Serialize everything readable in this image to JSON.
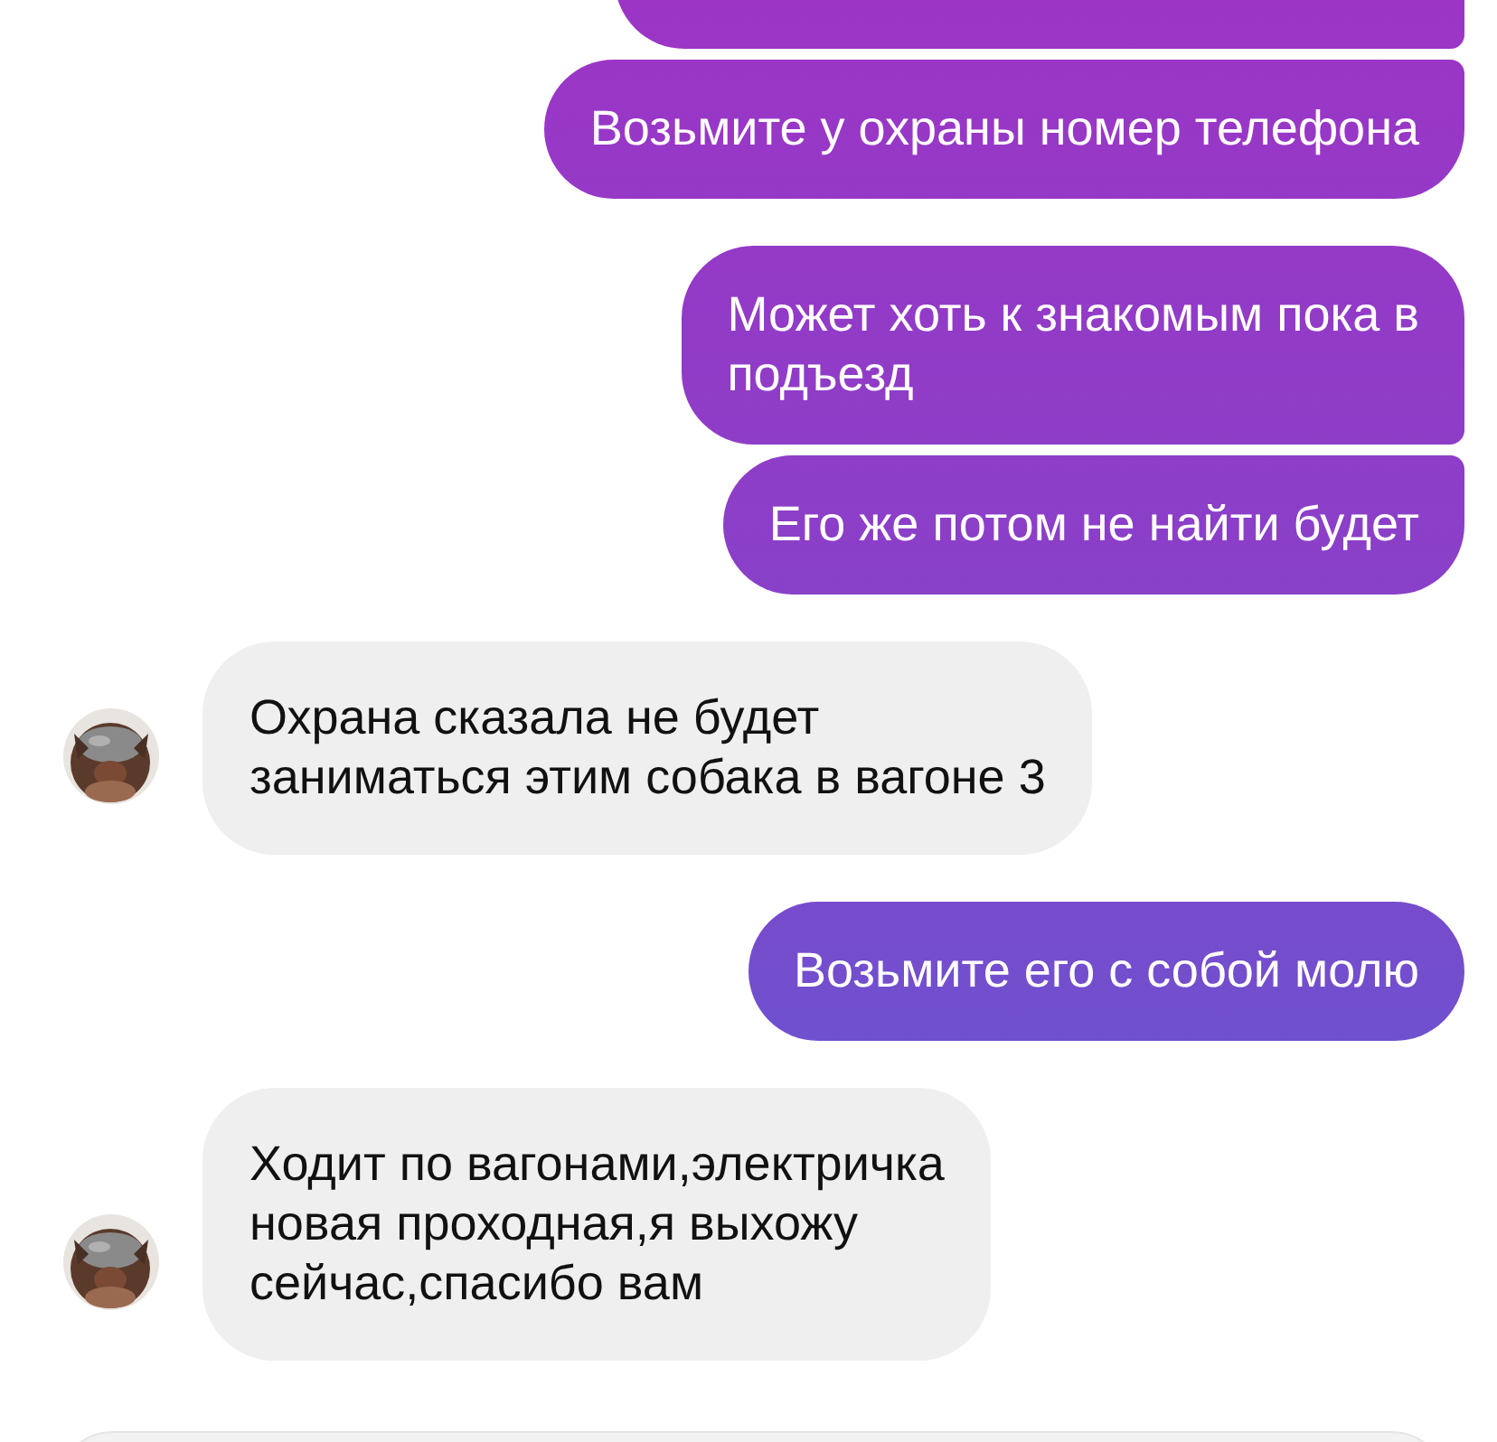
{
  "messages": [
    {
      "kind": "outgoing",
      "grouped": false
    },
    {
      "kind": "outgoing",
      "grouped": true,
      "lines": [
        "Возьмите у охраны номер телефона"
      ]
    },
    {
      "kind": "outgoing",
      "grouped": false,
      "lines": [
        "Может хоть к знакомым пока в",
        "подъезд"
      ]
    },
    {
      "kind": "outgoing",
      "grouped": true,
      "lines": [
        "Его же потом не найти будет"
      ]
    },
    {
      "kind": "incoming",
      "grouped": false,
      "lines": [
        "Охрана сказала не будет",
        "заниматься этим собака в вагоне 3"
      ]
    },
    {
      "kind": "outgoing",
      "grouped": false,
      "lines": [
        "Возьмите его с собой молю"
      ]
    },
    {
      "kind": "incoming",
      "grouped": false,
      "lines": [
        "Ходит по вагонами,электричка",
        "новая проходная,я выхожу",
        "сейчас,спасибо вам"
      ]
    }
  ]
}
